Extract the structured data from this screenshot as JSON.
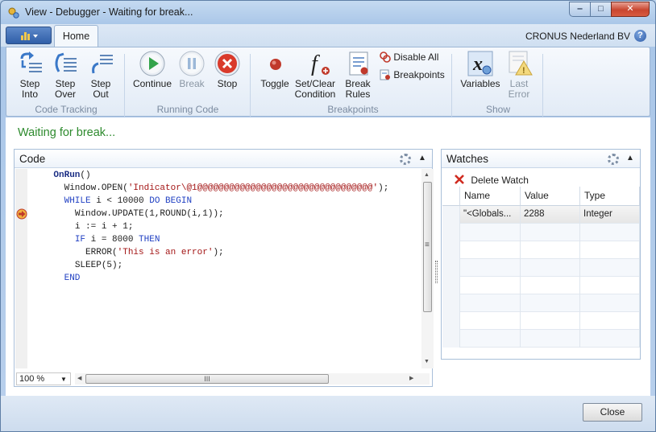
{
  "window": {
    "title": "View - Debugger - Waiting for break...",
    "minimize": "‒",
    "maximize": "□",
    "close": "✕"
  },
  "header": {
    "tab": "Home",
    "company": "CRONUS Nederland BV",
    "help": "?"
  },
  "ribbon": {
    "code_tracking": {
      "group": "Code Tracking",
      "step_into": "Step\nInto",
      "step_over": "Step\nOver",
      "step_out": "Step\nOut"
    },
    "running_code": {
      "group": "Running Code",
      "continue": "Continue",
      "break": "Break",
      "stop": "Stop"
    },
    "breakpoints": {
      "group": "Breakpoints",
      "toggle": "Toggle",
      "set_clear": "Set/Clear\nCondition",
      "break_rules": "Break\nRules",
      "disable_all": "Disable All",
      "breakpoints": "Breakpoints"
    },
    "show": {
      "group": "Show",
      "variables": "Variables",
      "last_error": "Last\nError"
    }
  },
  "status": "Waiting for break...",
  "code_panel": {
    "title": "Code",
    "lines": [
      {
        "indent": "    ",
        "parts": [
          {
            "t": "OnRun",
            "c": "onrun"
          },
          {
            "t": "()",
            "c": "nm"
          }
        ]
      },
      {
        "indent": "      ",
        "parts": [
          {
            "t": "Window.OPEN(",
            "c": "nm"
          },
          {
            "t": "'Indicator\\@1@@@@@@@@@@@@@@@@@@@@@@@@@@@@@@@@@'",
            "c": "str"
          },
          {
            "t": ");",
            "c": "nm"
          }
        ]
      },
      {
        "indent": "      ",
        "parts": [
          {
            "t": "WHILE",
            "c": "kw"
          },
          {
            "t": " i < 10000 ",
            "c": "nm"
          },
          {
            "t": "DO BEGIN",
            "c": "kw"
          }
        ]
      },
      {
        "indent": "        ",
        "parts": [
          {
            "t": "Window.UPDATE(1,ROUND(i,1));",
            "c": "nm"
          }
        ]
      },
      {
        "indent": "        ",
        "parts": [
          {
            "t": "i := i + 1;",
            "c": "nm"
          }
        ]
      },
      {
        "indent": "        ",
        "parts": [
          {
            "t": "IF",
            "c": "kw"
          },
          {
            "t": " i = 8000 ",
            "c": "nm"
          },
          {
            "t": "THEN",
            "c": "kw"
          }
        ]
      },
      {
        "indent": "          ",
        "parts": [
          {
            "t": "ERROR(",
            "c": "nm"
          },
          {
            "t": "'This is an error'",
            "c": "str"
          },
          {
            "t": ");",
            "c": "nm"
          }
        ]
      },
      {
        "indent": "        ",
        "parts": [
          {
            "t": "SLEEP(5);",
            "c": "nm"
          }
        ]
      },
      {
        "indent": "      ",
        "parts": [
          {
            "t": "END",
            "c": "kw"
          }
        ]
      }
    ],
    "zoom": "100 %",
    "hscroll_grip": "III",
    "vscroll_grip": "≡"
  },
  "watches_panel": {
    "title": "Watches",
    "delete_watch": "Delete Watch",
    "columns": [
      "Name",
      "Value",
      "Type"
    ],
    "rows": [
      [
        "\"<Globals...",
        "2288",
        "Integer"
      ]
    ]
  },
  "footer": {
    "close": "Close"
  },
  "colors": {
    "accent": "#2d8a2d",
    "keyword": "#1f3fc2",
    "string": "#a31515"
  }
}
